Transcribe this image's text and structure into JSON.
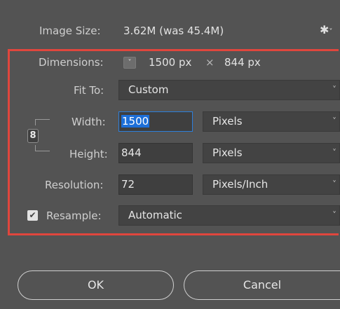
{
  "image_size": {
    "label": "Image Size:",
    "value": "3.62M (was 45.4M)"
  },
  "gear_icon_glyph": "✱",
  "gear_icon_chevron": "˅",
  "dimensions": {
    "label": "Dimensions:",
    "width": "1500 px",
    "times": "×",
    "height": "844 px",
    "dropdown_glyph": "˅"
  },
  "fit_to": {
    "label": "Fit To:",
    "value": "Custom"
  },
  "width": {
    "label": "Width:",
    "value": "1500",
    "unit": "Pixels"
  },
  "height": {
    "label": "Height:",
    "value": "844",
    "unit": "Pixels"
  },
  "link_icon_glyph": "8",
  "resolution": {
    "label": "Resolution:",
    "value": "72",
    "unit": "Pixels/Inch"
  },
  "resample": {
    "label": "Resample:",
    "checked": true,
    "check_glyph": "✔",
    "value": "Automatic"
  },
  "chevron": "˅",
  "buttons": {
    "ok": "OK",
    "cancel": "Cancel"
  },
  "colors": {
    "background": "#535353",
    "highlight": "#e0463d",
    "selection": "#1d6fd8"
  }
}
